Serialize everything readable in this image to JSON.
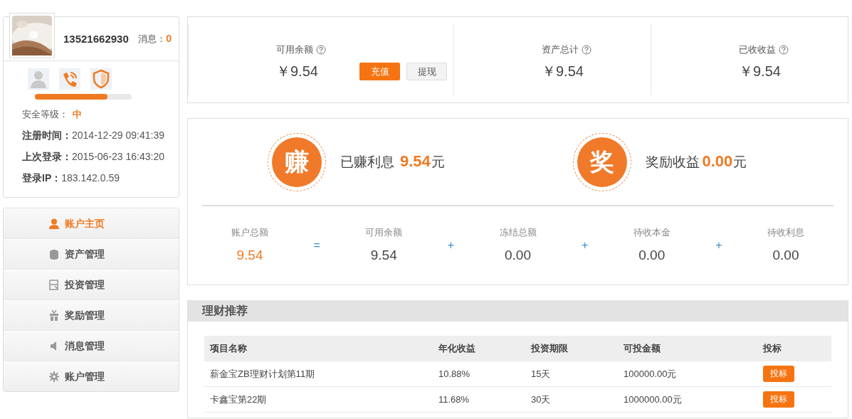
{
  "profile": {
    "username": "13521662930",
    "messages_label": "消息：",
    "messages_count": "0",
    "verifications": [
      {
        "kind": "identity",
        "verified": false
      },
      {
        "kind": "phone",
        "verified": true
      },
      {
        "kind": "security",
        "verified": true
      }
    ],
    "security": {
      "level": 0.75,
      "label": "安全等级：",
      "value": "中"
    },
    "info": [
      {
        "label": "注册时间：",
        "value": "2014-12-29 09:41:39"
      },
      {
        "label": "上次登录：",
        "value": "2015-06-23 16:43:20"
      },
      {
        "label": "登录IP：",
        "value": "183.142.0.59"
      }
    ]
  },
  "menu": [
    {
      "kind": "user",
      "label": "账户主页",
      "selected": true
    },
    {
      "kind": "coins",
      "label": "资产管理",
      "selected": false
    },
    {
      "kind": "invest",
      "label": "投资管理",
      "selected": false
    },
    {
      "kind": "gift",
      "label": "奖励管理",
      "selected": false
    },
    {
      "kind": "speaker",
      "label": "消息管理",
      "selected": false
    },
    {
      "kind": "gear",
      "label": "账户管理",
      "selected": false
    }
  ],
  "balances": [
    {
      "label": "可用余额",
      "value": "￥9.54",
      "buttons": [
        {
          "kind": "primary",
          "label": "充值"
        },
        {
          "kind": "secondary",
          "label": "提现"
        }
      ]
    },
    {
      "label": "资产总计",
      "value": "￥9.54"
    },
    {
      "label": "已收收益",
      "value": "￥9.54"
    }
  ],
  "earnings": [
    {
      "badge": "赚",
      "label": "已赚利息",
      "amount": "9.54",
      "unit": "元"
    },
    {
      "badge": "奖",
      "label": "奖励收益",
      "amount": "0.00",
      "unit": "元"
    }
  ],
  "breakdown": [
    {
      "label": "账户总额",
      "value": "9.54",
      "highlight": true
    },
    {
      "operator": "=",
      "label": "可用余额",
      "value": "9.54",
      "highlight": false
    },
    {
      "operator": "+",
      "label": "冻结总额",
      "value": "0.00",
      "highlight": false
    },
    {
      "operator": "+",
      "label": "待收本金",
      "value": "0.00",
      "highlight": false
    },
    {
      "operator": "+",
      "label": "待收利息",
      "value": "0.00",
      "highlight": false
    }
  ],
  "recommend": {
    "title": "理财推荐",
    "columns": [
      "项目名称",
      "年化收益",
      "投资期限",
      "可投金额",
      "投标"
    ],
    "rows": [
      {
        "cells": [
          "薪金宝ZB理财计划第11期",
          "10.88%",
          "15天",
          "100000.00元"
        ],
        "action": "投标"
      },
      {
        "cells": [
          "卡鑫宝第22期",
          "11.68%",
          "30天",
          "1000000.00元"
        ],
        "action": "投标"
      }
    ]
  }
}
